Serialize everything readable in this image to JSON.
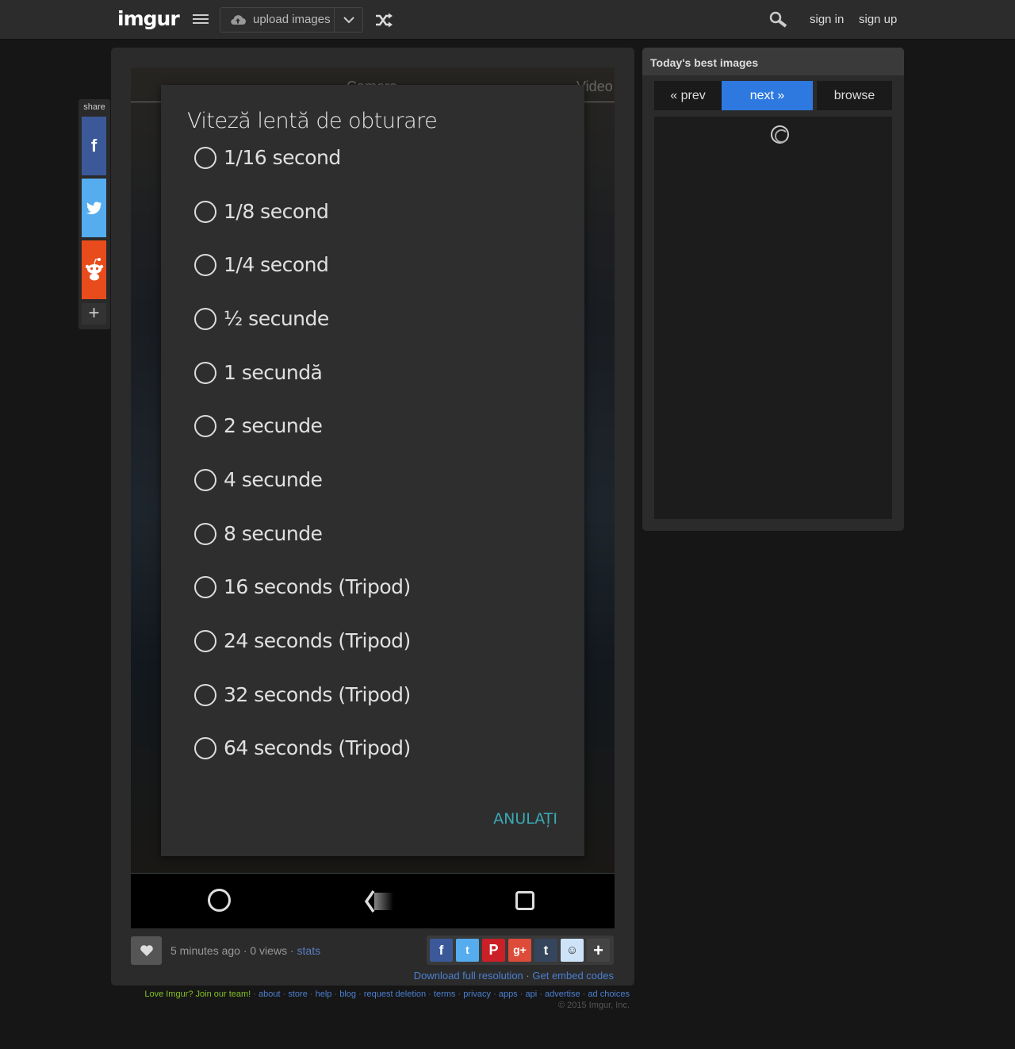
{
  "header": {
    "logo": "imgur",
    "upload_label": "upload images",
    "sign_in": "sign in",
    "sign_up": "sign up"
  },
  "share": {
    "label": "share"
  },
  "screenshot": {
    "tab_camera": "Camera",
    "tab_video": "Video",
    "dialog": {
      "title": "Viteză lentă de obturare",
      "options": [
        "1/16 second",
        "1/8 second",
        "1/4 second",
        "½ secunde",
        "1 secundă",
        "2 secunde",
        "4 secunde",
        "8 secunde",
        "16 seconds (Tripod)",
        "24 seconds (Tripod)",
        "32 seconds (Tripod)",
        "64 seconds (Tripod)"
      ],
      "cancel": "ANULAȚI"
    }
  },
  "image_meta": {
    "time_views": "5 minutes ago · 0 views ·",
    "stats": "stats",
    "download": "Download full resolution",
    "embed": "Get embed codes"
  },
  "best": {
    "title": "Today's best images",
    "prev": "« prev",
    "next": "next »",
    "browse": "browse"
  },
  "footer": {
    "join": "Love Imgur? Join our team!",
    "links": [
      "about",
      "store",
      "help",
      "blog",
      "request deletion",
      "terms",
      "privacy",
      "apps",
      "api",
      "advertise",
      "ad choices"
    ],
    "copyright": "© 2015 Imgur, Inc."
  },
  "colors": {
    "accent_blue": "#2d79e0",
    "cancel_teal": "#3aa9b5",
    "join_green": "#85bf25"
  }
}
